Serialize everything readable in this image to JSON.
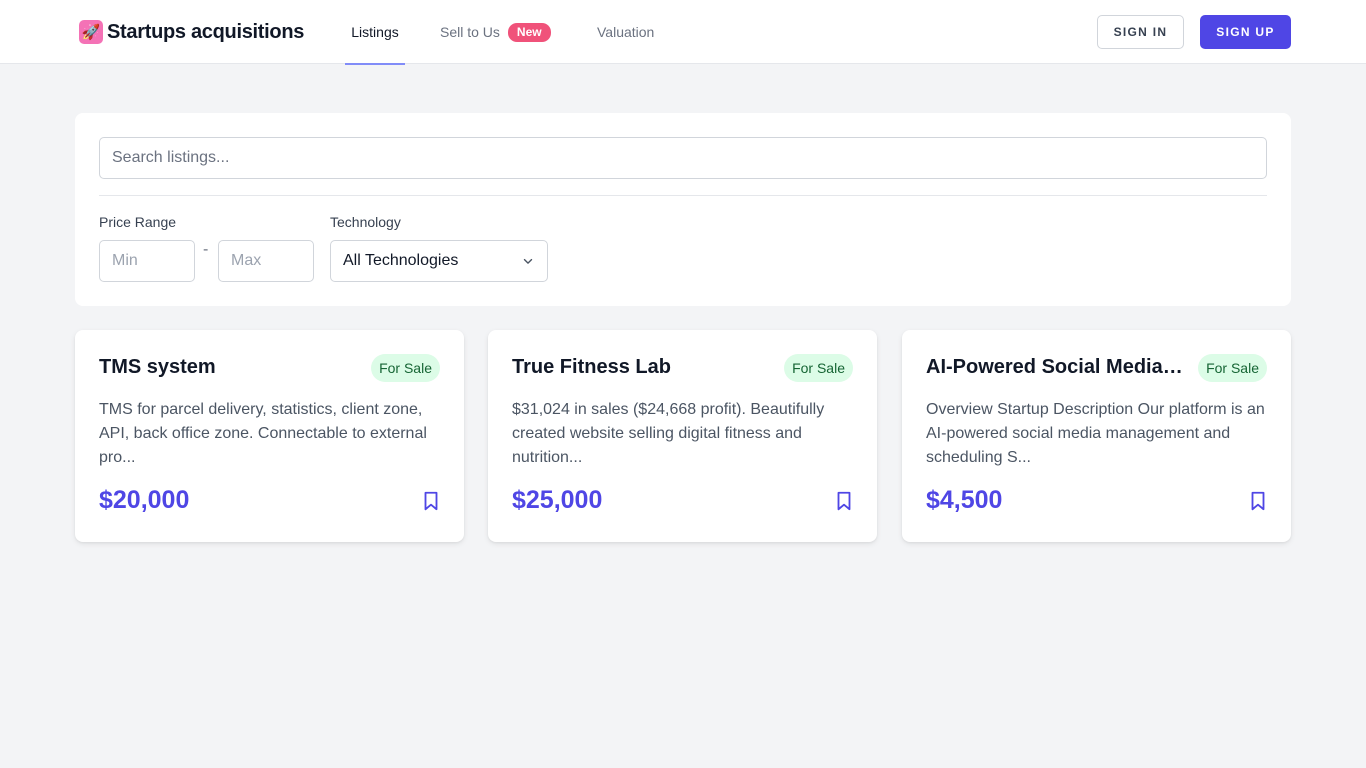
{
  "header": {
    "brand": {
      "logo_icon": "rocket-icon",
      "logo_glyph": "🚀",
      "name": "Startups acquisitions"
    },
    "nav": [
      {
        "label": "Listings",
        "active": true
      },
      {
        "label": "Sell to Us",
        "badge": "New"
      },
      {
        "label": "Valuation"
      }
    ],
    "sign_in": "SIGN IN",
    "sign_up": "SIGN UP"
  },
  "filters": {
    "search_placeholder": "Search listings...",
    "price_label": "Price Range",
    "min_placeholder": "Min",
    "max_placeholder": "Max",
    "separator": "-",
    "technology_label": "Technology",
    "technology_selected": "All Technologies"
  },
  "listings": [
    {
      "title": "TMS system",
      "status": "For Sale",
      "description": "TMS for parcel delivery, statistics, client zone, API, back office zone. Connectable to external pro...",
      "price": "$20,000"
    },
    {
      "title": "True Fitness Lab",
      "status": "For Sale",
      "description": "$31,024 in sales ($24,668 profit). Beautifully created website selling digital fitness and nutrition...",
      "price": "$25,000"
    },
    {
      "title": "AI-Powered Social Media Management",
      "status": "For Sale",
      "description": "Overview Startup Description Our platform is an AI-powered social media management and scheduling S...",
      "price": "$4,500"
    }
  ],
  "colors": {
    "accent": "#4f46e5",
    "badge_new": "#f0527a",
    "for_sale_bg": "#dcfce7",
    "for_sale_text": "#166534"
  }
}
